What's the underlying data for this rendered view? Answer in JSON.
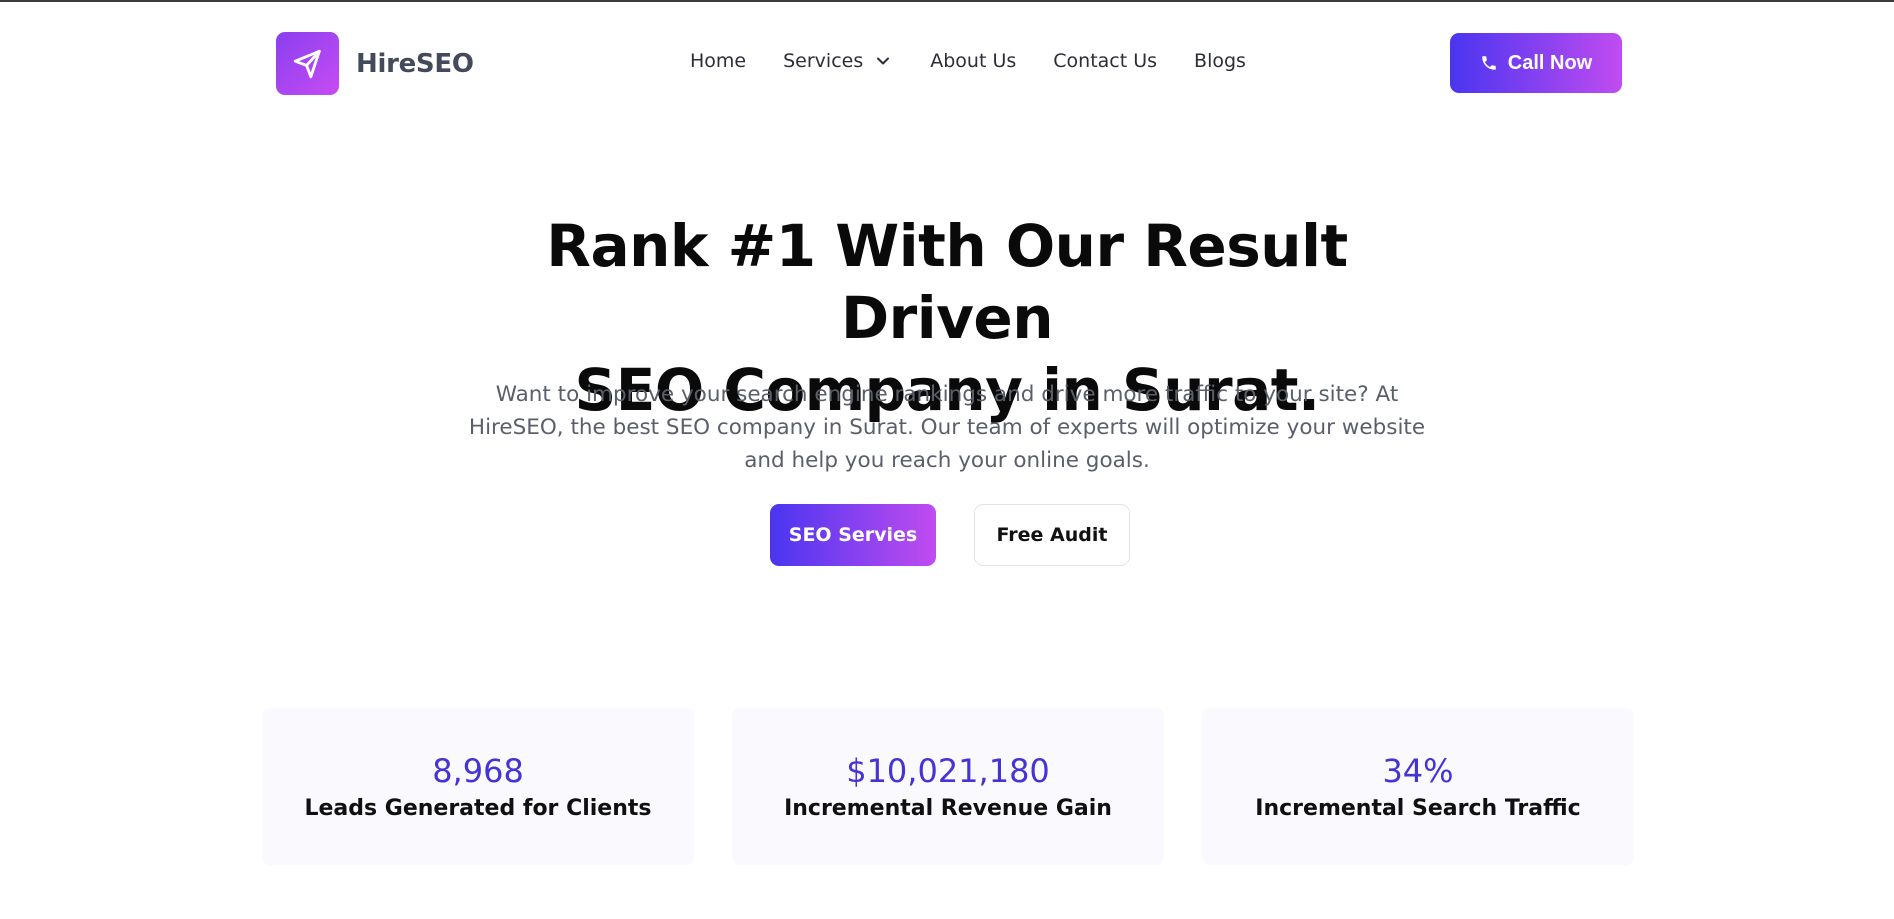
{
  "brand": {
    "name": "HireSEO",
    "accent_start": "#4a35f0",
    "accent_end": "#c04cf0",
    "logo_icon": "paper-plane-icon"
  },
  "nav": {
    "items": [
      {
        "label": "Home"
      },
      {
        "label": "Services",
        "has_dropdown": true
      },
      {
        "label": "About Us"
      },
      {
        "label": "Contact Us"
      },
      {
        "label": "Blogs"
      }
    ]
  },
  "header": {
    "cta_label": "Call Now",
    "cta_icon": "phone-icon"
  },
  "hero": {
    "title_line1": "Rank #1 With Our Result Driven",
    "title_line2": "SEO Company in Surat.",
    "description": "Want to improve your search engine rankings and drive more traffic to your site? At HireSEO, the best SEO company in Surat. Our team of experts will optimize your website and help you reach your online goals.",
    "primary_button": "SEO Servies",
    "secondary_button": "Free Audit"
  },
  "stats": [
    {
      "value": "8,968",
      "label": "Leads Generated for Clients"
    },
    {
      "value": "$10,021,180",
      "label": "Incremental Revenue Gain"
    },
    {
      "value": "34%",
      "label": "Incremental Search Traffic"
    }
  ]
}
